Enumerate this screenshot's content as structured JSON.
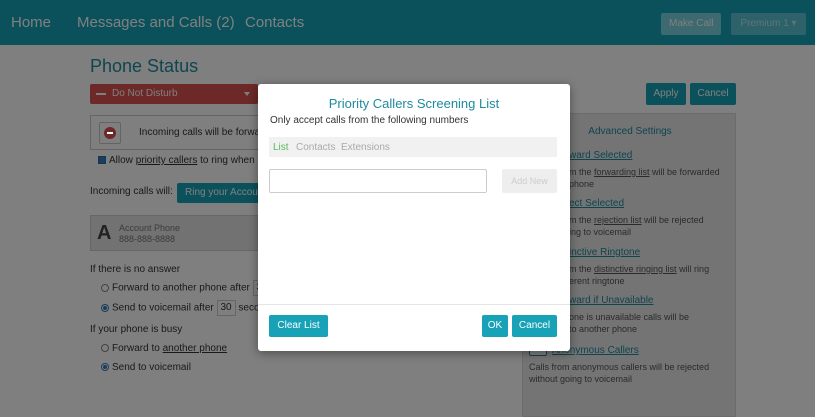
{
  "nav": {
    "home": "Home",
    "messages": "Messages and Calls (2)",
    "contacts": "Contacts",
    "make_call": "Make Call",
    "premium": "Premium 1 ▾"
  },
  "page": {
    "title": "Phone Status",
    "status_select": "Do Not Disturb",
    "apply": "Apply",
    "cancel": "Cancel",
    "incoming_forward_text": "Incoming calls will be forwa",
    "allow_prefix": "Allow ",
    "allow_link": "priority callers",
    "allow_suffix": " to ring when in",
    "incoming_label": "Incoming calls will:",
    "ring_button": "Ring your Accou",
    "account_letter": "A",
    "account_name": "Account Phone",
    "account_number": "888-888-8888",
    "no_answer_label": "If there is no answer",
    "forward_after": "Forward to another phone after",
    "forward_after_value": "3",
    "voicemail_after": "Send to voicemail after",
    "voicemail_after_value": "30",
    "voicemail_after_unit": "secon",
    "busy_label": "If your phone is busy",
    "busy_forward_prefix": "Forward to ",
    "busy_forward_link": "another phone",
    "busy_voicemail": "Send to voicemail"
  },
  "advanced": {
    "title": "Advanced Settings",
    "items": [
      {
        "link": "ward Selected",
        "desc1": "m the ",
        "desc1_link": "forwarding list",
        "desc1_suffix": " will be forwarded",
        "desc2": "phone"
      },
      {
        "link": "ect Selected",
        "desc1": "m the ",
        "desc1_link": "rejection list",
        "desc1_suffix": " will be rejected",
        "desc2": "ing to voicemail"
      },
      {
        "link": "inctive Ringtone",
        "desc1": "m the ",
        "desc1_link": "distinctive ringing list",
        "desc1_suffix": " will ring",
        "desc2": "erent ringtone"
      },
      {
        "link": "ward if Unavailable",
        "desc1": "one is unavailable calls will be",
        "desc1_link": "",
        "desc1_suffix": "",
        "desc2": "to another phone"
      }
    ],
    "anon_link": "Anonymous Callers",
    "anon_desc1": "Calls from anonymous callers will be rejected",
    "anon_desc2": "without going to voicemail"
  },
  "modal": {
    "title": "Priority Callers Screening List",
    "subtitle": "Only accept calls from the following numbers",
    "tabs": [
      "List",
      "Contacts",
      "Extensions"
    ],
    "number_input_value": "",
    "add_new": "Add New",
    "clear_list": "Clear List",
    "ok": "OK",
    "cancel": "Cancel"
  },
  "colors": {
    "accent": "#17a2b8",
    "danger": "#d9534f",
    "active_tab": "#5cb85c"
  }
}
